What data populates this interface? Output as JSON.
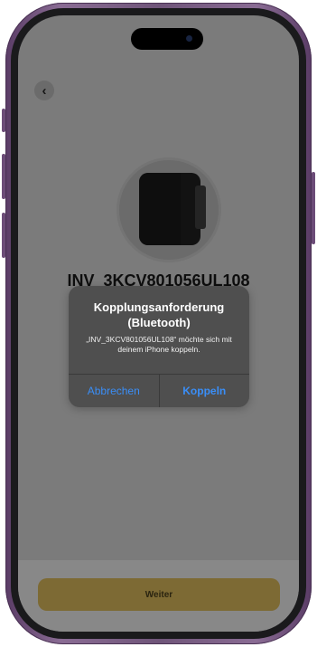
{
  "screen": {
    "back_icon": "chevron-left-icon",
    "device_image": "inverter-device-image",
    "device_name": "INV_3KCV801056UL108"
  },
  "dialog": {
    "title": "Kopplungsanforderung (Bluetooth)",
    "message": "„INV_3KCV801056UL108“ möchte sich mit deinem iPhone koppeln.",
    "cancel_label": "Abbrechen",
    "confirm_label": "Koppeln",
    "accent_color": "#3a8ef7"
  },
  "footer": {
    "continue_label": "Weiter",
    "button_color": "#7d6a34"
  }
}
